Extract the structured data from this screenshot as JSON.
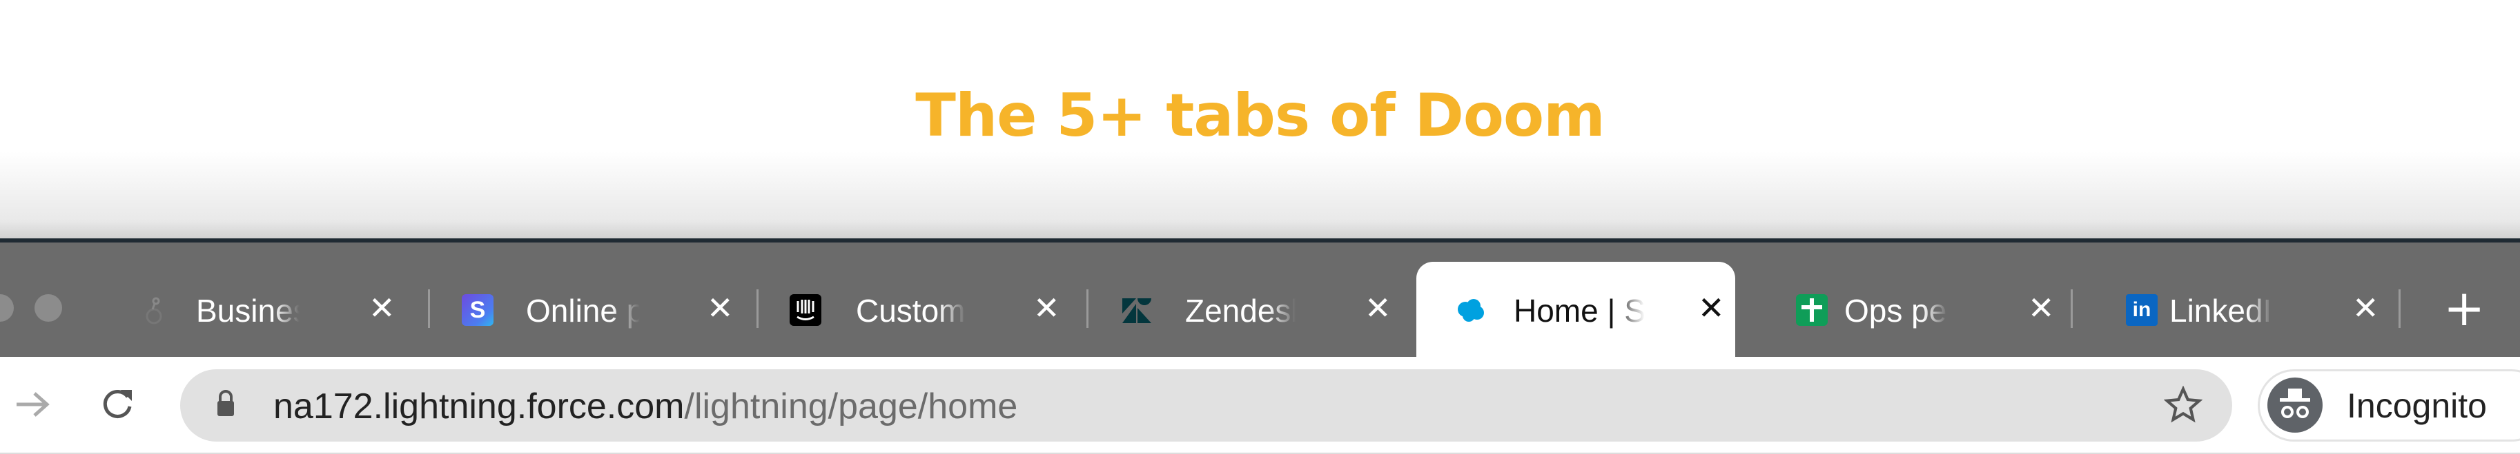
{
  "banner": {
    "title": "The 5+ tabs of Doom",
    "title_color": "#f6b42a"
  },
  "tabs": [
    {
      "title": "Business f",
      "favicon": "bot-icon",
      "active": false
    },
    {
      "title": "Online pay",
      "favicon": "stripe-icon",
      "favicon_color": "#635bff",
      "active": false
    },
    {
      "title": "Customer",
      "favicon": "intercom-icon",
      "favicon_color": "#000000",
      "active": false
    },
    {
      "title": "Zendesk |",
      "favicon": "zendesk-icon",
      "favicon_color": "#03363d",
      "active": false
    },
    {
      "title": "Home | Sa",
      "favicon": "salesforce-icon",
      "favicon_color": "#00a1e0",
      "active": true
    },
    {
      "title": "Ops peop",
      "favicon": "google-sheets-icon",
      "favicon_color": "#0f9d58",
      "active": false
    },
    {
      "title": "LinkedIn: f",
      "favicon": "linkedin-icon",
      "favicon_color": "#0a66c2",
      "active": false
    }
  ],
  "close_glyph": "✕",
  "new_tab_glyph": "+",
  "toolbar": {
    "url_host": "na172.lightning.force.com",
    "url_path": "/lightning/page/home",
    "profile_label": "Incognito"
  },
  "favicon_text": {
    "stripe": "S",
    "linkedin": "in"
  }
}
